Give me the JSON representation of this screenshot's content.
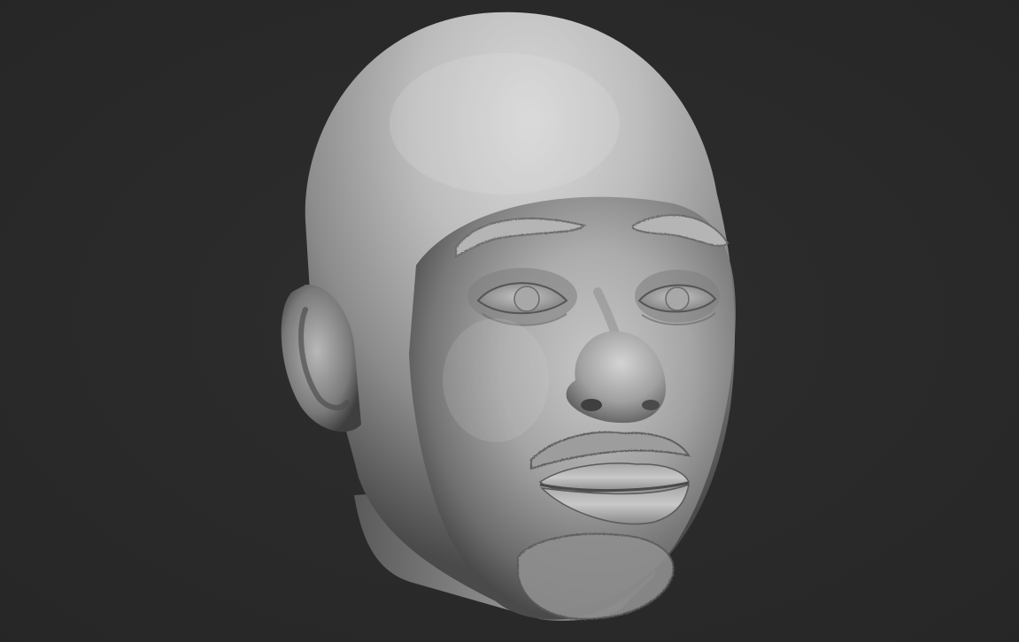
{
  "viewport": {
    "background_color": "#2b2b2b",
    "background_edge_color": "#262626",
    "model_base_color": "#9a9a9a",
    "model_highlight_color": "#dcdcdc",
    "model_shadow_color": "#3a3a3a"
  },
  "model": {
    "subject": "sculpted-human-head",
    "material": "matte-clay-gray"
  }
}
